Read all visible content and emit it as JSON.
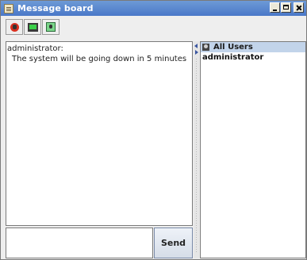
{
  "window": {
    "title": "Message board"
  },
  "toolbar": {
    "icons": [
      "user-icon",
      "screen-icon",
      "monitor-icon"
    ]
  },
  "messages": [
    {
      "author": "administrator:",
      "text": "The system will be going down in 5 minutes"
    }
  ],
  "input": {
    "value": ""
  },
  "send": {
    "label": "Send"
  },
  "users": {
    "header": "All Users",
    "items": [
      "administrator"
    ]
  }
}
